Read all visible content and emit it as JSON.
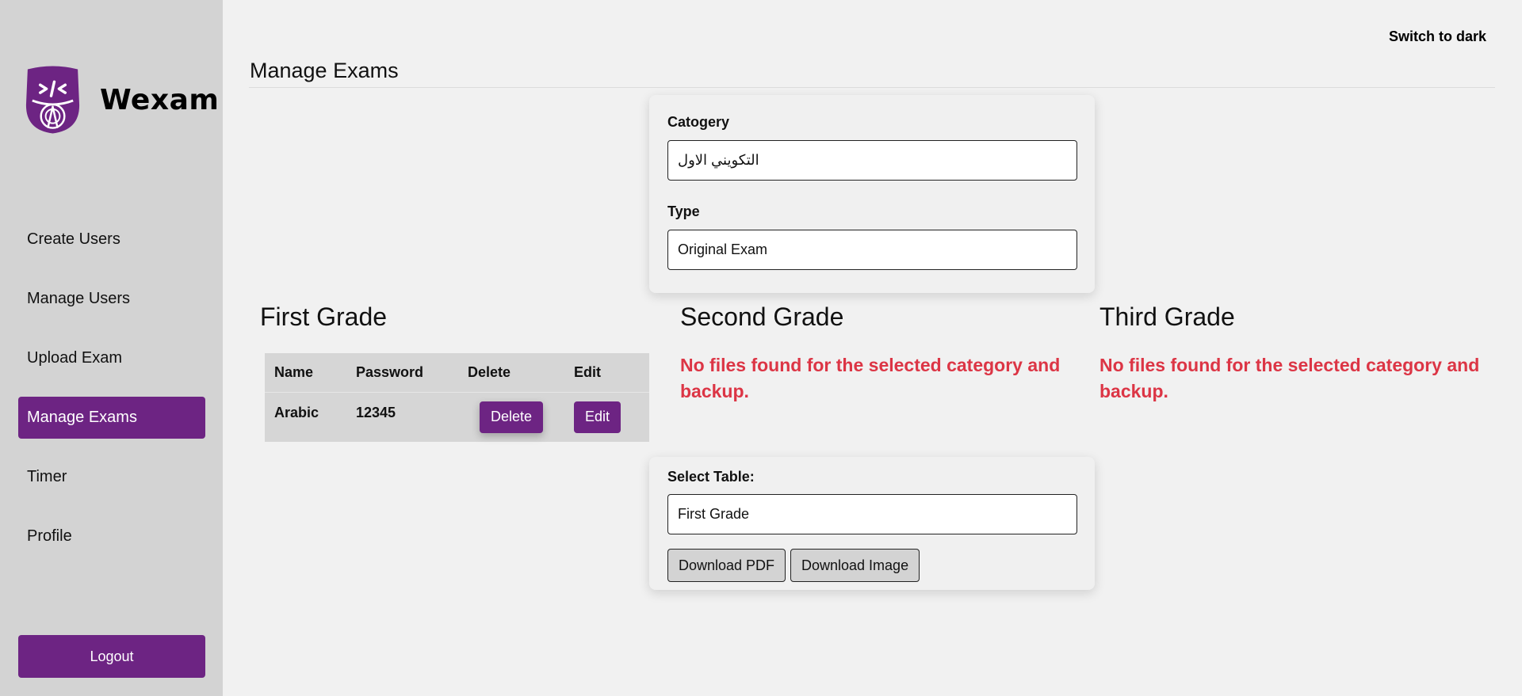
{
  "brand": {
    "name": "Wexam",
    "logo_icon": "code-shield-logo",
    "accent_color": "#6d2483"
  },
  "sidebar": {
    "items": [
      {
        "label": "Create Users",
        "active": false
      },
      {
        "label": "Manage Users",
        "active": false
      },
      {
        "label": "Upload Exam",
        "active": false
      },
      {
        "label": "Manage Exams",
        "active": true
      },
      {
        "label": "Timer",
        "active": false
      },
      {
        "label": "Profile",
        "active": false
      }
    ],
    "logout_label": "Logout"
  },
  "header": {
    "theme_toggle": "Switch to dark",
    "page_title": "Manage Exams"
  },
  "filters": {
    "category_label": "Catogery",
    "category_value": "التكويني الاول",
    "type_label": "Type",
    "type_value": "Original Exam"
  },
  "grades": [
    {
      "title": "First Grade",
      "table": {
        "headers": [
          "Name",
          "Password",
          "Delete",
          "Edit"
        ],
        "rows": [
          {
            "name": "Arabic",
            "password": "12345",
            "delete_label": "Delete",
            "edit_label": "Edit"
          }
        ]
      }
    },
    {
      "title": "Second Grade",
      "empty_message": "No files found for the selected category and backup."
    },
    {
      "title": "Third Grade",
      "empty_message": "No files found for the selected category and backup."
    }
  ],
  "export": {
    "select_label": "Select Table:",
    "select_value": "First Grade",
    "pdf_label": "Download PDF",
    "image_label": "Download Image"
  },
  "colors": {
    "error": "#dc3545",
    "sidebar_bg": "#d3d3d3",
    "page_bg": "#f1f1f1"
  }
}
